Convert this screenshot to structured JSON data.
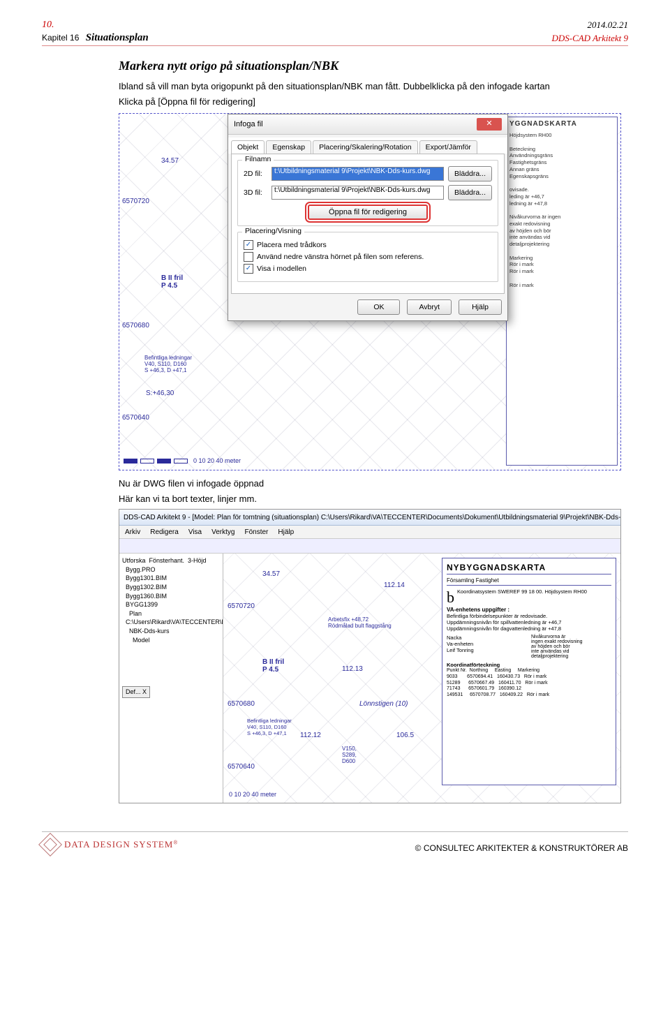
{
  "header": {
    "page_no": "10.",
    "date": "2014.02.21",
    "chapter": "Kapitel 16",
    "section": "Situationsplan",
    "product": "DDS-CAD Arkitekt 9"
  },
  "body": {
    "h2": "Markera nytt origo på situationsplan/NBK",
    "p1": "Ibland så vill man byta origopunkt på den situationsplan/NBK man fått. Dubbelklicka på den infogade kartan",
    "p2": "Klicka på [Öppna fil för redigering]",
    "p3": "Nu är DWG filen vi infogade öppnad",
    "p4": "Här kan vi ta bort texter, linjer mm."
  },
  "dialog": {
    "title": "Infoga fil",
    "tabs": [
      "Objekt",
      "Egenskap",
      "Placering/Skalering/Rotation",
      "Export/Jämför"
    ],
    "grp_file": "Filnamn",
    "lbl_2d": "2D fil:",
    "val_2d": "t:\\Utbildningsmaterial 9\\Projekt\\NBK-Dds-kurs.dwg",
    "lbl_3d": "3D fil:",
    "val_3d": "t:\\Utbildningsmaterial 9\\Projekt\\NBK-Dds-kurs.dwg",
    "browse": "Bläddra...",
    "open_edit": "Öppna fil för redigering",
    "grp_place": "Placering/Visning",
    "chk1": "Placera med trådkors",
    "chk2": "Använd nedre vänstra hörnet på filen som referens.",
    "chk3": "Visa i modellen",
    "ok": "OK",
    "cancel": "Avbryt",
    "help": "Hjälp"
  },
  "map": {
    "title": "YGGNADSKARTA",
    "height1": "34.57",
    "coord1": "6570720",
    "coord2": "6570680",
    "coord3": "6570640",
    "lot": "B II fril\nP 4.5",
    "h2": "112.12",
    "h3": "106.5",
    "sd": "S:+46,30",
    "bef": "Befintliga ledningar\nV40, S110, D160\nS +46,3, D +47,1",
    "scale": "0    10    20         40 meter",
    "side_lines": "Höjdsystem RH00\n\nBeteckning\nAnvändningsgräns\nFastighetsgräns\nAnnan gräns\nEgenskapsgräns\n\novisade.\nleding är +46,7\nledning är +47,8\n\nNivåkurvorna är ingen\nexakt redovisning\nav höjden och bör\ninte användas vid\ndetaljprojektering\n\nMarkering\nRör i mark\nRör i mark\n\nRör i mark"
  },
  "win2": {
    "title": "DDS-CAD Arkitekt 9 - [Model: Plan för tomtning (situationsplan)  C:\\Users\\Rikard\\VA\\TECCENTER\\Documents\\Dokument\\Utbildningsmaterial 9\\Projekt\\NBK-Dds-kurs.dwg ]",
    "menus": [
      "Arkiv",
      "Redigera",
      "Visa",
      "Verktyg",
      "Fönster",
      "Hjälp"
    ],
    "tree": "Utforska  Fönsterhant.  3-Höjd\n  Bygg.PRO\n  Bygg1301.BIM\n  Bygg1302.BIM\n  Bygg1360.BIM\n  BYGG1399\n    Plan\n  C:\\Users\\Rikard\\VA\\TECCENTER\\Doc\n    NBK-Dds-kurs\n      Model",
    "def": "Def... X",
    "card_title": "NYBYGGNADSKARTA",
    "card_sub": "Församling        Fastighet",
    "coordsys": "Koordinatsystem SWEREF 99 18 00. Höjdsystem RH00",
    "va_h": "VA-enhetens uppgifter :",
    "va": "Befintliga förbindelsepunkter är redovisade.\nUppdämningsnivån för spillvattenledning är +46,7\nUppdämningsnivån för dagvattenledning är +47,8",
    "nacka": "Nacka\nVa-enheten\nLeif Tonring",
    "curve": "Nivåkurvorna är\ningen exakt redovisning\nav höjden och bör\ninte användas vid\ndetaljprojektering",
    "coord_h": "Koordinatförteckning",
    "coord_tbl": "Punkt Nr.  Northing     Easting     Markering\n9033       6570694.41   160430.73   Rör i mark\n51289      6570667.49   160411.70   Rör i mark\n71743      6570601.79   160390.12\n149531     6570708.77   160409.22   Rör i mark",
    "ann1": "Arbetsfix +48,72\nRödmålad bult flaggstång",
    "ann2": "112.14",
    "ann3": "112.13",
    "ann4": "112.12",
    "ann5": "106.5",
    "ann6": "Lönnstigen (10)",
    "ann7": "V150,\nS289,\nD600",
    "scale": "0    10    20         40 meter"
  },
  "footer": {
    "brand": "DATA DESIGN SYSTEM",
    "reg": "®",
    "right": "© CONSULTEC ARKITEKTER & KONSTRUKTÖRER AB"
  }
}
